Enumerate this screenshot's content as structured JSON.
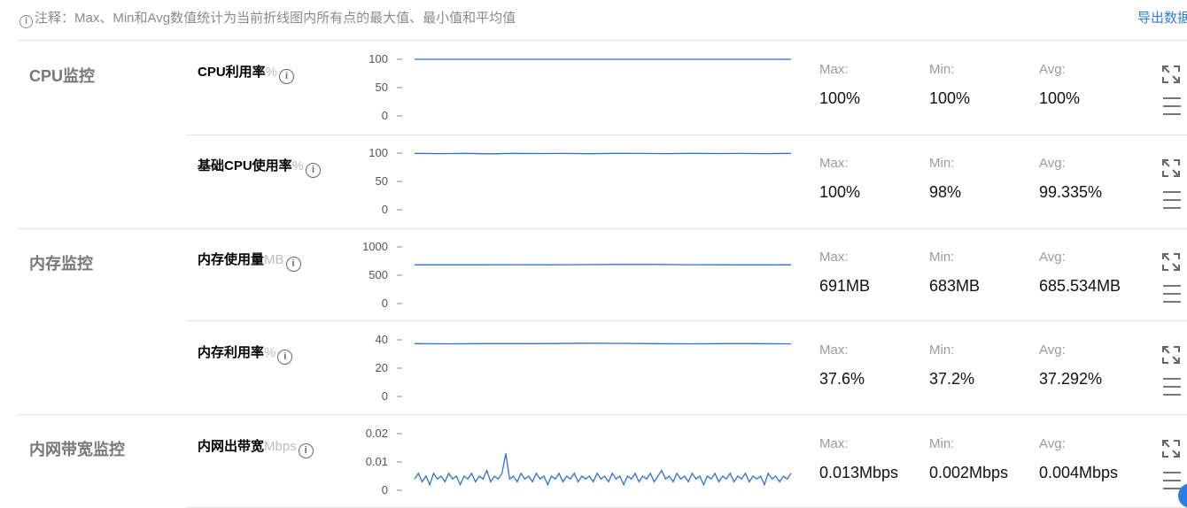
{
  "note": {
    "text": "注释：Max、Min和Avg数值统计为当前折线图内所有点的最大值、最小值和平均值",
    "icon": "info-icon"
  },
  "export_label": "导出数据",
  "groups": [
    {
      "title": "CPU监控"
    },
    {
      "title": "内存监控"
    },
    {
      "title": "内网带宽监控"
    }
  ],
  "metrics": [
    {
      "name": "CPU利用率",
      "unit": "%",
      "ticks": [
        "100",
        "50",
        "0"
      ],
      "stats": {
        "max_label": "Max:",
        "max": "100%",
        "min_label": "Min:",
        "min": "100%",
        "avg_label": "Avg:",
        "avg": "100%"
      },
      "chart_data": {
        "type": "line",
        "ylim": [
          0,
          100
        ],
        "series": [
          {
            "values": [
              100,
              100,
              100,
              100,
              100,
              100,
              100,
              100,
              100,
              100
            ]
          }
        ]
      }
    },
    {
      "name": "基础CPU使用率",
      "unit": "%",
      "ticks": [
        "100",
        "50",
        "0"
      ],
      "stats": {
        "max_label": "Max:",
        "max": "100%",
        "min_label": "Min:",
        "min": "98%",
        "avg_label": "Avg:",
        "avg": "99.335%"
      },
      "chart_data": {
        "type": "line",
        "ylim": [
          0,
          100
        ],
        "series": [
          {
            "values": [
              99.5,
              99,
              99.5,
              98.8,
              99.6,
              99.2,
              99.4,
              98.9,
              99.5,
              99.3,
              99.1,
              99.6,
              99.2,
              99.4,
              99,
              99.5
            ]
          }
        ]
      }
    },
    {
      "name": "内存使用量",
      "unit": "MB",
      "ticks": [
        "1000",
        "500",
        "0"
      ],
      "stats": {
        "max_label": "Max:",
        "max": "691MB",
        "min_label": "Min:",
        "min": "683MB",
        "avg_label": "Avg:",
        "avg": "685.534MB"
      },
      "chart_data": {
        "type": "line",
        "ylim": [
          0,
          1000
        ],
        "series": [
          {
            "values": [
              685,
              684,
              685,
              686,
              685,
              688,
              691,
              690,
              686,
              684,
              683,
              685
            ]
          }
        ]
      }
    },
    {
      "name": "内存利用率",
      "unit": "%",
      "ticks": [
        "40",
        "20",
        "0"
      ],
      "stats": {
        "max_label": "Max:",
        "max": "37.6%",
        "min_label": "Min:",
        "min": "37.2%",
        "avg_label": "Avg:",
        "avg": "37.292%"
      },
      "chart_data": {
        "type": "line",
        "ylim": [
          0,
          40
        ],
        "series": [
          {
            "values": [
              37.3,
              37.2,
              37.3,
              37.3,
              37.4,
              37.6,
              37.5,
              37.3,
              37.2,
              37.3,
              37.3,
              37.2
            ]
          }
        ]
      }
    },
    {
      "name": "内网出带宽",
      "unit": "Mbps",
      "ticks": [
        "0.02",
        "0.01",
        "0"
      ],
      "stats": {
        "max_label": "Max:",
        "max": "0.013Mbps",
        "min_label": "Min:",
        "min": "0.002Mbps",
        "avg_label": "Avg:",
        "avg": "0.004Mbps"
      },
      "chart_data": {
        "type": "line",
        "ylim": [
          0,
          0.02
        ],
        "series": [
          {
            "values": [
              0.004,
              0.006,
              0.003,
              0.005,
              0.002,
              0.006,
              0.004,
              0.005,
              0.003,
              0.006,
              0.004,
              0.005,
              0.002,
              0.005,
              0.004,
              0.006,
              0.003,
              0.005,
              0.004,
              0.007,
              0.003,
              0.005,
              0.004,
              0.006,
              0.013,
              0.004,
              0.005,
              0.003,
              0.006,
              0.004,
              0.005,
              0.003,
              0.006,
              0.004,
              0.005,
              0.002,
              0.005,
              0.004,
              0.006,
              0.003,
              0.005,
              0.004,
              0.006,
              0.003,
              0.005,
              0.004,
              0.005,
              0.003,
              0.006,
              0.004,
              0.005,
              0.003,
              0.006,
              0.004,
              0.005,
              0.002,
              0.005,
              0.004,
              0.006,
              0.003,
              0.005,
              0.004,
              0.006,
              0.003,
              0.005,
              0.007,
              0.004,
              0.005,
              0.003,
              0.006,
              0.004,
              0.005,
              0.003,
              0.006,
              0.004,
              0.005,
              0.002,
              0.005,
              0.004,
              0.006,
              0.003,
              0.005,
              0.004,
              0.006,
              0.003,
              0.005,
              0.004,
              0.006,
              0.003,
              0.005,
              0.004,
              0.005,
              0.002,
              0.006,
              0.004,
              0.005,
              0.003,
              0.005,
              0.004,
              0.006
            ]
          }
        ]
      }
    }
  ]
}
